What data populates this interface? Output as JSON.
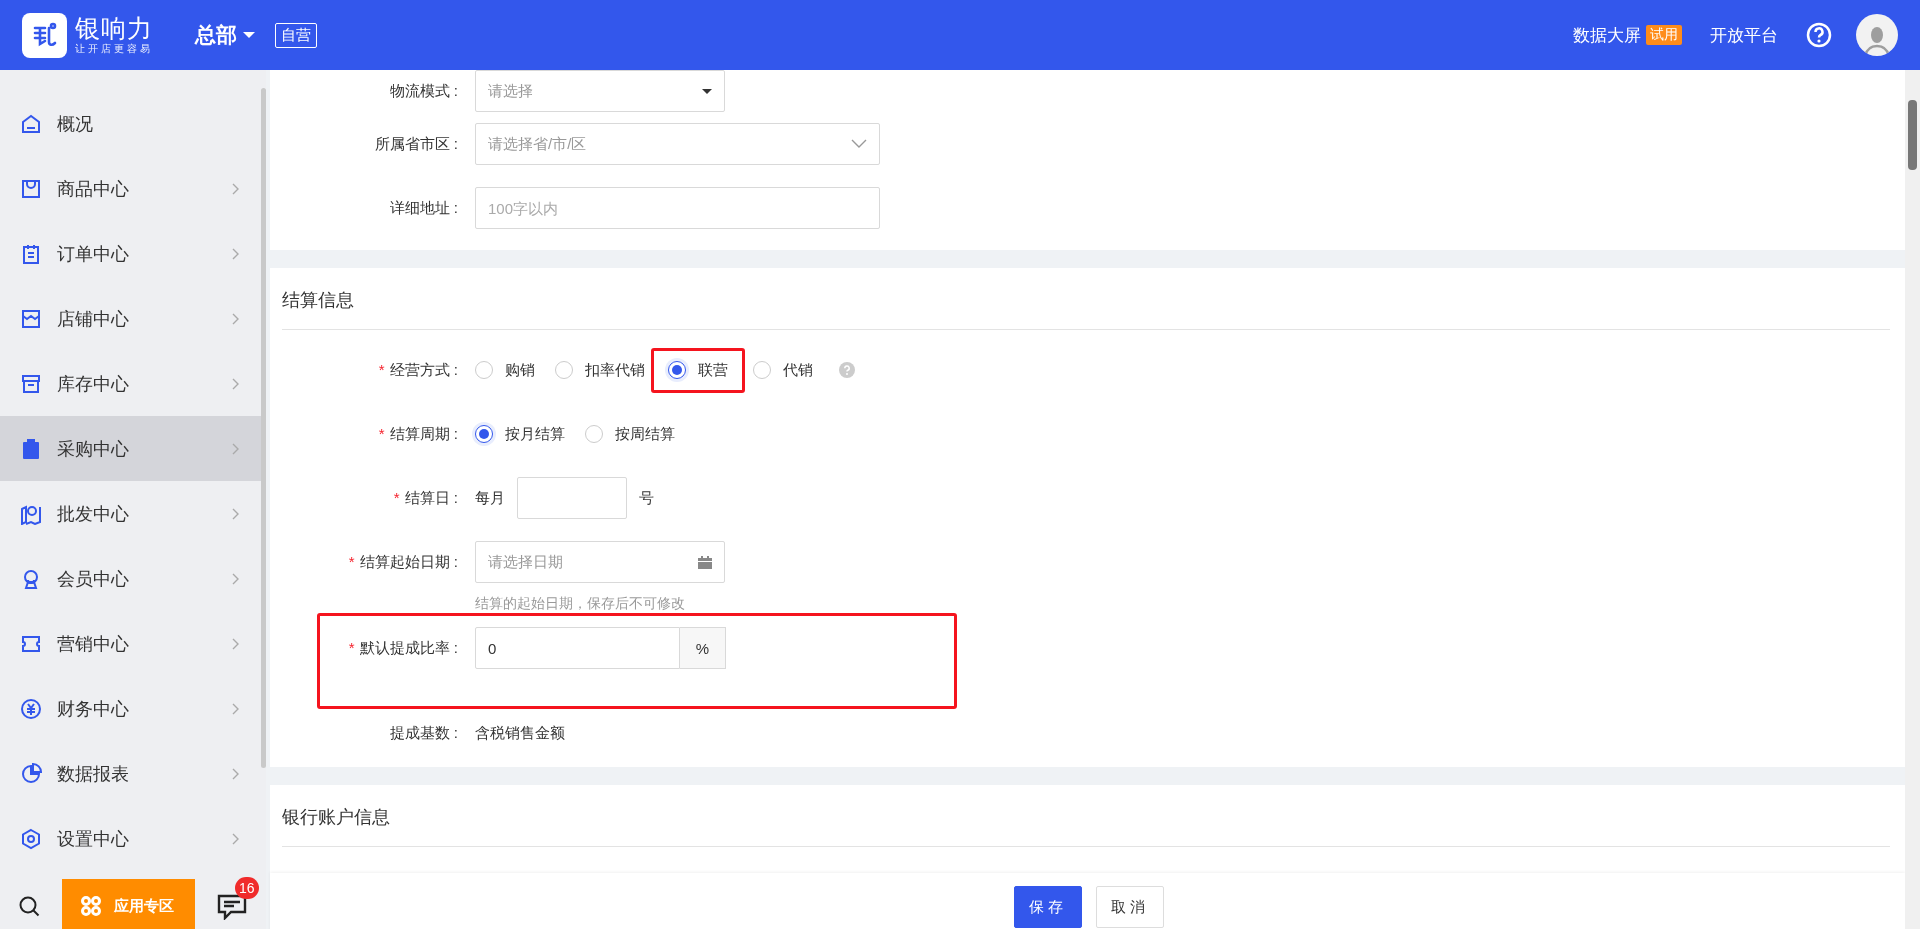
{
  "header": {
    "brand": "银响力",
    "slogan": "让开店更容易",
    "org": "总部",
    "tag": "自营",
    "links": [
      {
        "label": "数据大屏",
        "badge": "试用"
      },
      {
        "label": "开放平台"
      }
    ]
  },
  "sidebar": {
    "items": [
      {
        "label": "概况",
        "selected": false,
        "arrow": false
      },
      {
        "label": "商品中心",
        "selected": false,
        "arrow": true
      },
      {
        "label": "订单中心",
        "selected": false,
        "arrow": true
      },
      {
        "label": "店铺中心",
        "selected": false,
        "arrow": true
      },
      {
        "label": "库存中心",
        "selected": false,
        "arrow": true
      },
      {
        "label": "采购中心",
        "selected": true,
        "arrow": true
      },
      {
        "label": "批发中心",
        "selected": false,
        "arrow": true
      },
      {
        "label": "会员中心",
        "selected": false,
        "arrow": true
      },
      {
        "label": "营销中心",
        "selected": false,
        "arrow": true
      },
      {
        "label": "财务中心",
        "selected": false,
        "arrow": true
      },
      {
        "label": "数据报表",
        "selected": false,
        "arrow": true
      },
      {
        "label": "设置中心",
        "selected": false,
        "arrow": true
      }
    ],
    "app_button": "应用专区",
    "message_count": "16"
  },
  "sections": [
    {
      "rows": [
        {
          "kind": "dropdown",
          "label": "物流模式 :",
          "placeholder": "请选择"
        },
        {
          "kind": "cascader",
          "label": "所属省市区 :",
          "placeholder": "请选择省/市/区"
        },
        {
          "kind": "text",
          "label": "详细地址 :",
          "placeholder": "100字以内"
        }
      ]
    },
    {
      "title": "结算信息",
      "rows": [
        {
          "kind": "radio",
          "required_mark": "*",
          "label": "经营方式 :",
          "help_icon": true,
          "options": [
            {
              "label": "购销",
              "selected": false,
              "highlighted": false
            },
            {
              "label": "扣率代销",
              "selected": false,
              "highlighted": false
            },
            {
              "label": "联营",
              "selected": true,
              "highlighted": true
            },
            {
              "label": "代销",
              "selected": false,
              "highlighted": false
            }
          ]
        },
        {
          "kind": "radio",
          "required_mark": "*",
          "label": "结算周期 :",
          "help_icon": false,
          "options": [
            {
              "label": "按月结算",
              "selected": true,
              "highlighted": false
            },
            {
              "label": "按周结算",
              "selected": false,
              "highlighted": false
            }
          ]
        },
        {
          "kind": "day",
          "required_mark": "*",
          "label": "结算日 :",
          "prefix": "每月",
          "suffix": "号"
        },
        {
          "kind": "date",
          "required_mark": "*",
          "label": "结算起始日期 :",
          "placeholder": "请选择日期",
          "hint": "结算的起始日期，保存后不可修改"
        },
        {
          "kind": "rate",
          "required_mark": "*",
          "label": "默认提成比率 :",
          "value": "0",
          "addon": "%",
          "highlighted": true
        },
        {
          "kind": "static",
          "label": "提成基数 :",
          "value": "含税销售金额"
        }
      ]
    },
    {
      "title": "银行账户信息"
    }
  ],
  "footer": {
    "buttons": [
      {
        "label": "保存",
        "primary": true
      },
      {
        "label": "取消",
        "primary": false
      }
    ]
  }
}
